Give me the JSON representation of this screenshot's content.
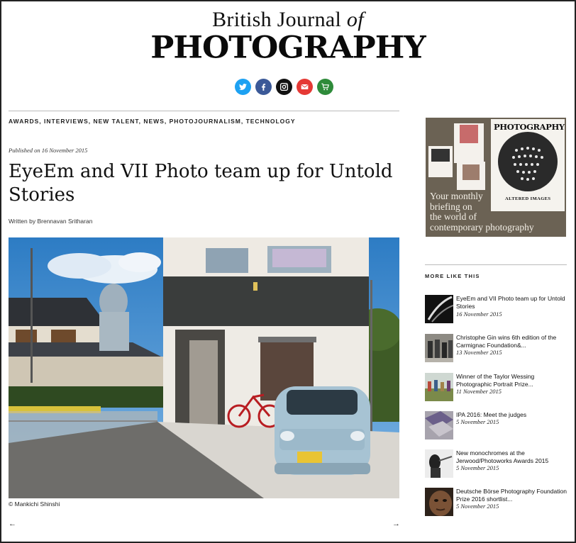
{
  "masthead": {
    "top_line": "British Journal ",
    "top_italic": "of",
    "main": "PHOTOGRAPHY"
  },
  "social": [
    {
      "name": "twitter-icon",
      "color": "#1da1f2"
    },
    {
      "name": "facebook-icon",
      "color": "#3b5998"
    },
    {
      "name": "instagram-icon",
      "color": "#111111"
    },
    {
      "name": "email-icon",
      "color": "#e53935"
    },
    {
      "name": "cart-icon",
      "color": "#2e8b3a"
    }
  ],
  "article": {
    "categories": "AWARDS, INTERVIEWS, NEW TALENT, NEWS, PHOTOJOURNALISM, TECHNOLOGY",
    "published": "Published on 16 November 2015",
    "title": "EyeEm and VII Photo team up for Untold Stories",
    "byline": "Written by Brennavan Sritharan",
    "photo_credit": "© Mankichi Shinshi",
    "prev_arrow": "←",
    "next_arrow": "→"
  },
  "ad": {
    "magazine_title": "PHOTOGRAPHY",
    "magazine_caption": "ALTERED IMAGES",
    "line1": "Your monthly",
    "line2": "briefing on",
    "line3": "the world of",
    "line4": "contemporary photography"
  },
  "more_like_this": {
    "heading": "MORE LIKE THIS",
    "items": [
      {
        "title": "EyeEm and VII Photo team up for Untold Stories",
        "date": "16 November 2015"
      },
      {
        "title": "Christophe Gin wins 6th edition of the Carmignac Foundation&...",
        "date": "13 November 2015"
      },
      {
        "title": "Winner of the Taylor Wessing Photographic Portrait Prize...",
        "date": "11 November 2015"
      },
      {
        "title": "IPA 2016: Meet the judges",
        "date": "5 November 2015"
      },
      {
        "title": "New monochromes at the Jerwood/Photoworks Awards 2015",
        "date": "5 November 2015"
      },
      {
        "title": "Deutsche Börse Photography Foundation Prize 2016 shortlist...",
        "date": "5 November 2015"
      }
    ]
  }
}
